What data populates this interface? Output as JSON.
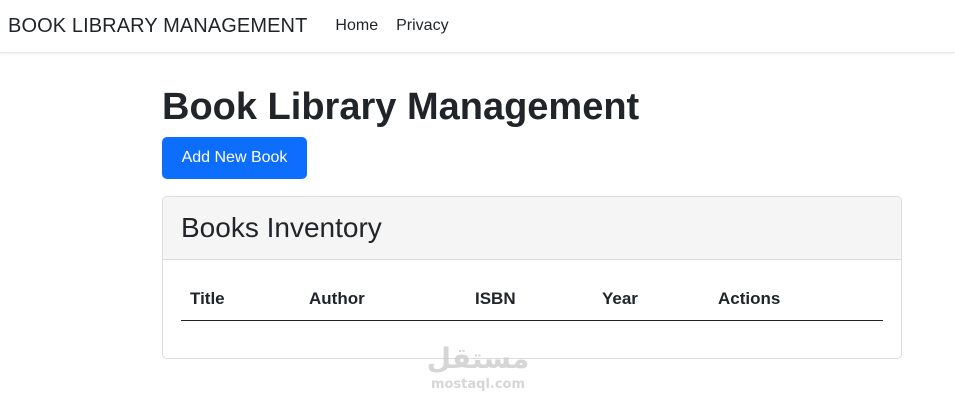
{
  "navbar": {
    "brand": "BOOK LIBRARY MANAGEMENT",
    "links": [
      {
        "label": "Home"
      },
      {
        "label": "Privacy"
      }
    ]
  },
  "main": {
    "title": "Book Library Management",
    "add_button_label": "Add New Book",
    "card": {
      "title": "Books Inventory",
      "table": {
        "headers": [
          "Title",
          "Author",
          "ISBN",
          "Year",
          "Actions"
        ],
        "rows": []
      }
    }
  },
  "watermark": {
    "arabic": "مستقل",
    "latin": "mostaql.com"
  },
  "colors": {
    "primary": "#0d6efd",
    "text": "#212529",
    "card_header_bg": "#f5f5f5",
    "border": "#dcdcdc"
  }
}
